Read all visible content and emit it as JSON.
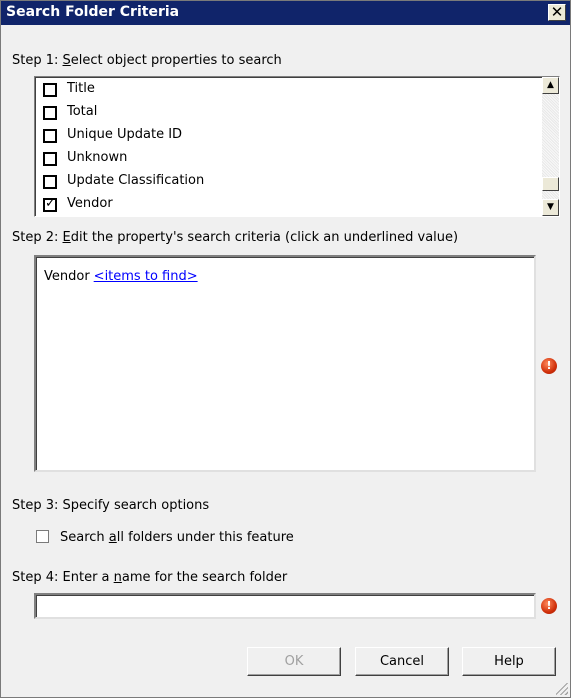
{
  "window": {
    "title": "Search Folder Criteria",
    "close_glyph": "✕"
  },
  "step1": {
    "prefix": "Step 1: ",
    "accel": "S",
    "rest": "elect object properties to search",
    "items": [
      {
        "label": "Title",
        "checked": false
      },
      {
        "label": "Total",
        "checked": false
      },
      {
        "label": "Unique Update ID",
        "checked": false
      },
      {
        "label": "Unknown",
        "checked": false
      },
      {
        "label": "Update Classification",
        "checked": false
      },
      {
        "label": "Vendor",
        "checked": true
      }
    ],
    "scroll_up_glyph": "▲",
    "scroll_down_glyph": "▼"
  },
  "step2": {
    "prefix": "Step 2: ",
    "accel": "E",
    "rest": "dit the property's search criteria (click an underlined value)",
    "criteria_property": "Vendor",
    "criteria_link": "<items to find>",
    "error_glyph": "!"
  },
  "step3": {
    "label": "Step 3: Specify search options",
    "checkbox_prefix": "Search ",
    "checkbox_accel": "a",
    "checkbox_rest": "ll folders under this feature",
    "checkbox_checked": false
  },
  "step4": {
    "prefix": "Step 4: Enter a ",
    "accel": "n",
    "rest": "ame for the search folder",
    "name_value": "",
    "error_glyph": "!"
  },
  "buttons": {
    "ok": "OK",
    "cancel": "Cancel",
    "help": "Help"
  },
  "colors": {
    "titlebar": "#10246a",
    "link": "#0000ff",
    "error": "#d0300a"
  }
}
